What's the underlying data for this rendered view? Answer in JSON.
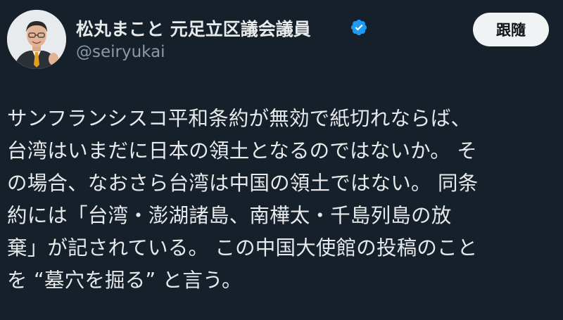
{
  "author": {
    "name": "松丸まこと 元足立区議会議員",
    "handle": "@seiryukai",
    "verified": true
  },
  "follow_button": {
    "label": "跟隨"
  },
  "tweet": {
    "lines": [
      "サンフランシスコ平和条約が無効で紙切れならば、",
      "台湾はいまだに日本の領土となるのではないか。 そ",
      "の場合、なおさら台湾は中国の領土ではない。 同条",
      "約には「台湾・澎湖諸島、南樺太・千島列島の放",
      "棄」が記されている。 この中国大使館の投稿のこと",
      "を “墓穴を掘る” と言う。"
    ]
  },
  "colors": {
    "background": "#15202b",
    "text": "#e7e9ea",
    "secondary_text": "#8b98a5",
    "verified_blue": "#1d9bf0",
    "button_bg": "#eff3f4"
  }
}
